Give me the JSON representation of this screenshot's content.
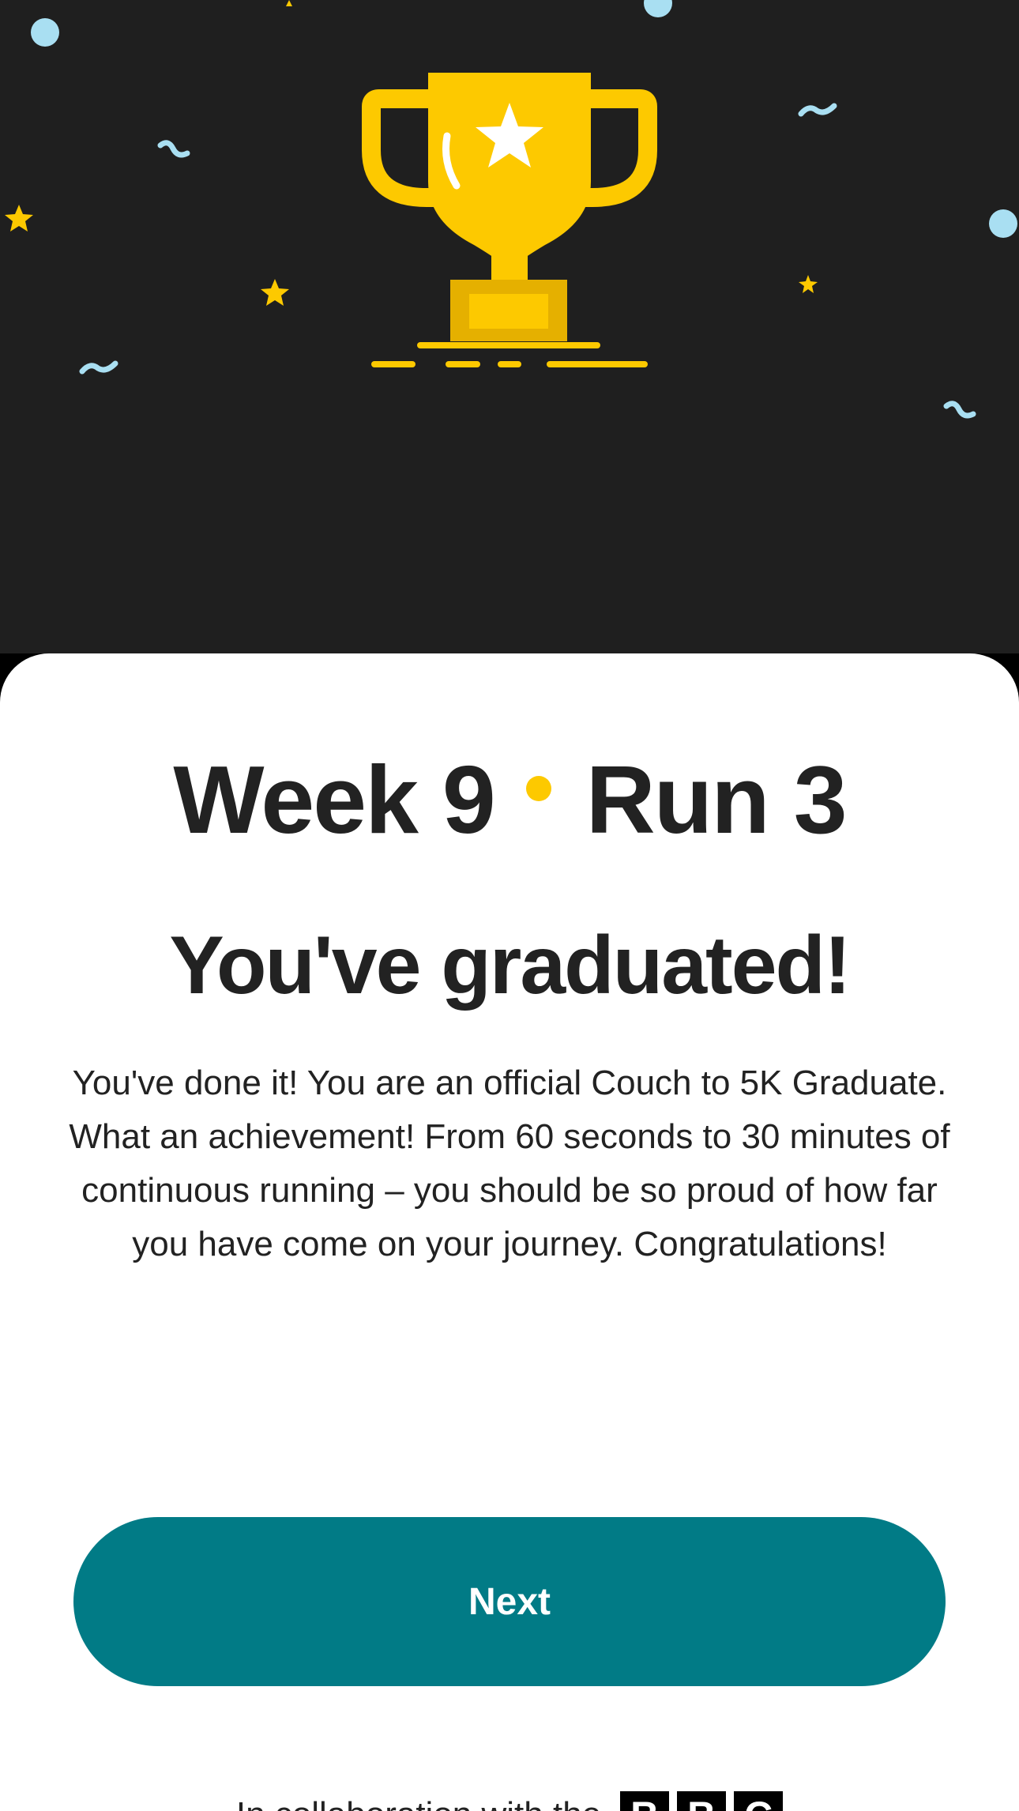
{
  "colors": {
    "hero_background": "#1f1f1f",
    "trophy_yellow": "#fdc900",
    "trophy_dark_yellow": "#e5b000",
    "confetti_blue": "#a9dff2",
    "accent_dot": "#fdc900",
    "button_background": "#017b86",
    "text": "#222222"
  },
  "icons": {
    "trophy": "trophy-icon",
    "trophy_star": "star-icon"
  },
  "run_header": {
    "week": "Week 9",
    "run": "Run 3"
  },
  "title": "You've graduated!",
  "body": "You've done it! You are an official Couch to 5K Graduate. What an achievement! From 60 seconds to 30 minutes of continuous running – you should be so proud of how far you have come on your journey. Congratulations!",
  "next_button": {
    "label": "Next"
  },
  "footer": {
    "collab_text": "In collaboration with the",
    "bbc_letters": [
      "B",
      "B",
      "C"
    ]
  }
}
